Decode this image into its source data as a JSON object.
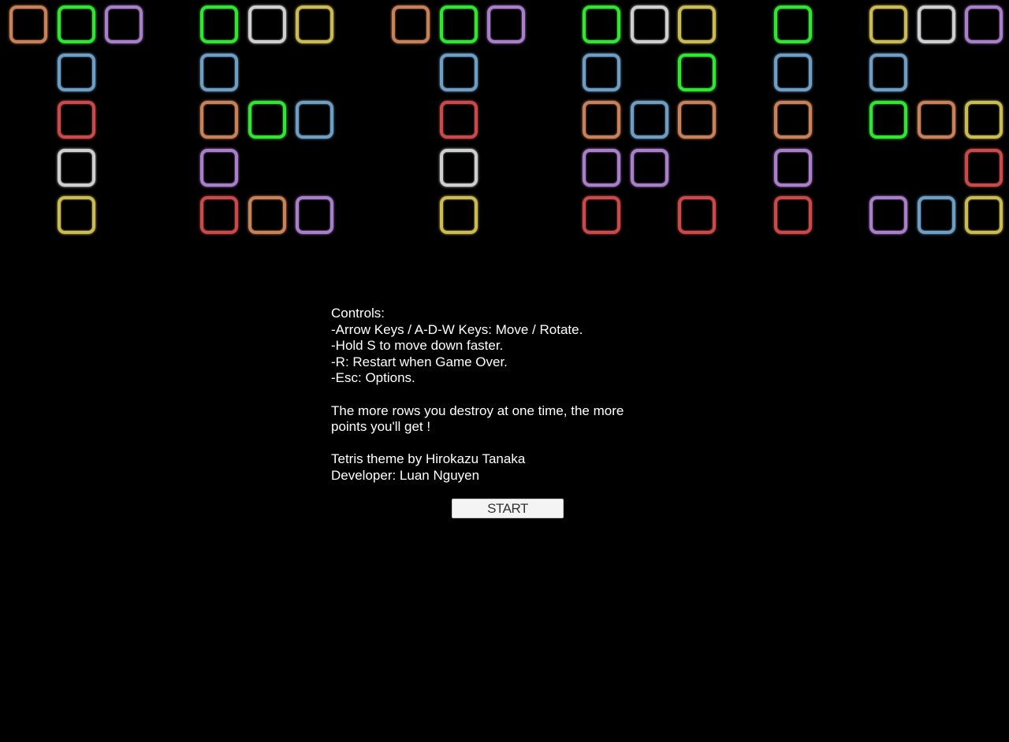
{
  "palette": {
    "orange": "#c9815a",
    "green": "#33e533",
    "purple": "#a97fc9",
    "gray": "#cfcfcf",
    "yellow": "#cbbb55",
    "blue": "#6f9ec4",
    "red": "#c94a4a"
  },
  "title_blocks": {
    "letters": [
      {
        "letter": "T",
        "rows": [
          [
            "orange",
            "green",
            "purple"
          ],
          [
            null,
            "blue",
            null
          ],
          [
            null,
            "red",
            null
          ],
          [
            null,
            "gray",
            null
          ],
          [
            null,
            "yellow",
            null
          ]
        ]
      },
      {
        "letter": "E",
        "rows": [
          [
            "green",
            "gray",
            "yellow"
          ],
          [
            "blue",
            null,
            null
          ],
          [
            "orange",
            "green",
            "blue"
          ],
          [
            "purple",
            null,
            null
          ],
          [
            "red",
            "orange",
            "purple"
          ]
        ]
      },
      {
        "letter": "T",
        "rows": [
          [
            "orange",
            "green",
            "purple"
          ],
          [
            null,
            "blue",
            null
          ],
          [
            null,
            "red",
            null
          ],
          [
            null,
            "gray",
            null
          ],
          [
            null,
            "yellow",
            null
          ]
        ]
      },
      {
        "letter": "R",
        "rows": [
          [
            "green",
            "gray",
            "yellow"
          ],
          [
            "blue",
            null,
            "green"
          ],
          [
            "orange",
            "blue",
            "orange"
          ],
          [
            "purple",
            "purple",
            null
          ],
          [
            "red",
            null,
            "red"
          ]
        ]
      },
      {
        "letter": "I",
        "rows": [
          [
            "green"
          ],
          [
            "blue"
          ],
          [
            "orange"
          ],
          [
            "purple"
          ],
          [
            "red"
          ]
        ]
      },
      {
        "letter": "S",
        "rows": [
          [
            "yellow",
            "gray",
            "purple"
          ],
          [
            "blue",
            null,
            null
          ],
          [
            "green",
            "orange",
            "yellow"
          ],
          [
            null,
            null,
            "red"
          ],
          [
            "purple",
            "blue",
            "yellow"
          ]
        ]
      }
    ]
  },
  "instructions": {
    "lines": [
      "Controls:",
      "-Arrow Keys / A-D-W Keys: Move / Rotate.",
      "-Hold S to move down faster.",
      "-R: Restart when Game Over.",
      "-Esc: Options.",
      "",
      "The more rows you destroy at one time, the more",
      "points you'll get !",
      "",
      "Tetris theme by Hirokazu Tanaka",
      "Developer: Luan Nguyen"
    ]
  },
  "start_button": {
    "label": "START"
  }
}
